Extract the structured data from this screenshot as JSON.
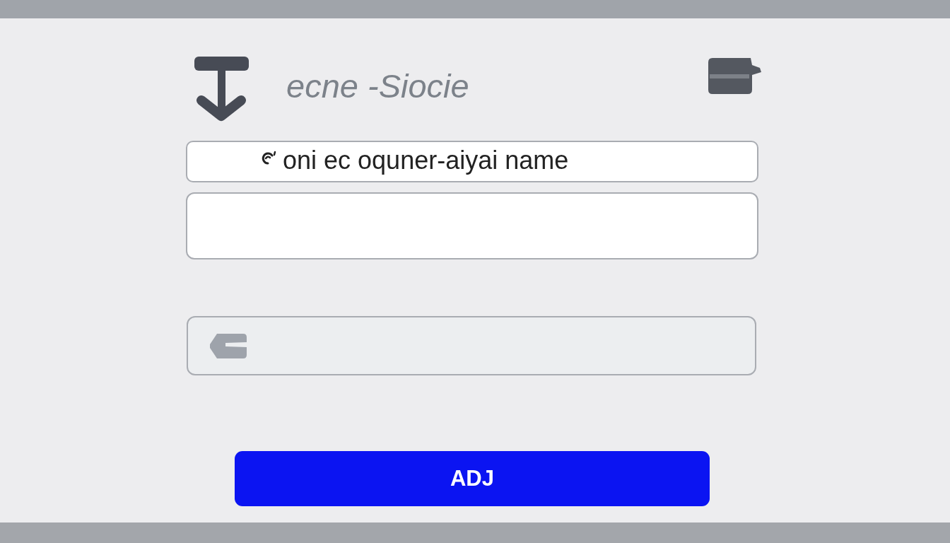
{
  "header": {
    "title": "ecne -Siocie"
  },
  "fields": [
    {
      "kind": "text",
      "value": "oni ec oquner-aiyai name"
    },
    {
      "kind": "multiline"
    },
    {
      "kind": "icon"
    }
  ],
  "button": {
    "label": "ADJ"
  }
}
